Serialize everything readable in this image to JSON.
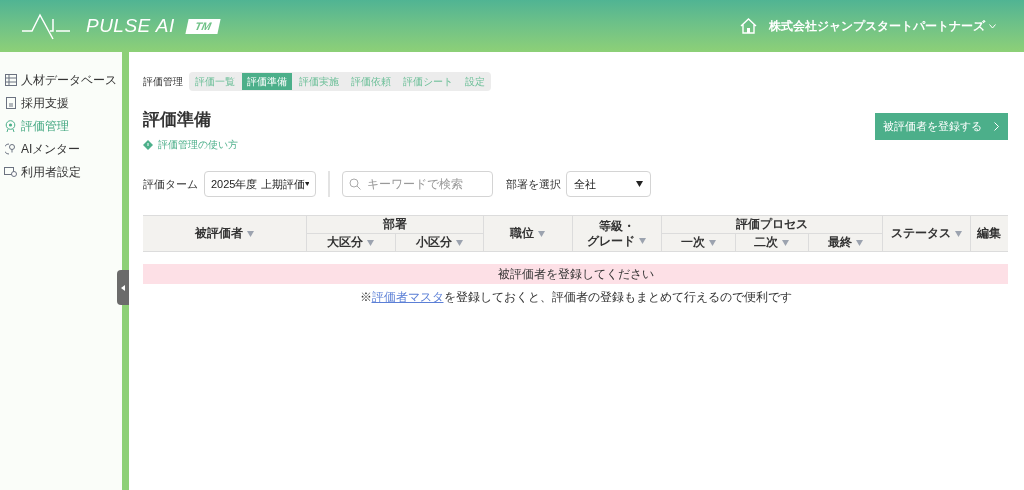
{
  "header": {
    "logo_text": "PULSE AI",
    "logo_badge": "TM",
    "company": "株式会社ジャンプスタートパートナーズ"
  },
  "sidebar": {
    "items": [
      {
        "label": "人材データベース",
        "selected": false
      },
      {
        "label": "採用支援",
        "selected": false
      },
      {
        "label": "評価管理",
        "selected": true
      },
      {
        "label": "AIメンター",
        "selected": false
      },
      {
        "label": "利用者設定",
        "selected": false
      }
    ]
  },
  "breadcrumb": "評価管理",
  "tabs": [
    {
      "label": "評価一覧",
      "selected": false
    },
    {
      "label": "評価準備",
      "selected": true
    },
    {
      "label": "評価実施",
      "selected": false
    },
    {
      "label": "評価依頼",
      "selected": false
    },
    {
      "label": "評価シート",
      "selected": false
    },
    {
      "label": "設定",
      "selected": false
    }
  ],
  "page_title": "評価準備",
  "help_link": "評価管理の使い方",
  "register_button": "被評価者を登録する",
  "filters": {
    "term_label": "評価ターム",
    "term_value": "2025年度 上期評価",
    "search_placeholder": "キーワードで検索",
    "dept_label": "部署を選択",
    "dept_value": "全社"
  },
  "table": {
    "columns": [
      {
        "label": "被評価者",
        "sortable": true
      },
      {
        "group": "部署",
        "children": [
          {
            "label": "大区分",
            "sortable": true
          },
          {
            "label": "小区分",
            "sortable": true
          }
        ]
      },
      {
        "label": "職位",
        "sortable": true
      },
      {
        "lines": [
          "等級・",
          "グレード"
        ],
        "sortable": true
      },
      {
        "group": "評価プロセス",
        "children": [
          {
            "label": "一次",
            "sortable": true
          },
          {
            "label": "二次",
            "sortable": true
          },
          {
            "label": "最終",
            "sortable": true
          }
        ]
      },
      {
        "label": "ステータス",
        "sortable": true
      },
      {
        "label": "編集",
        "sortable": false
      }
    ],
    "empty_message": "被評価者を登録してください"
  },
  "note": {
    "prefix": "※",
    "link": "評価者マスタ",
    "suffix": "を登録しておくと、評価者の登録もまとめて行えるので便利です"
  }
}
